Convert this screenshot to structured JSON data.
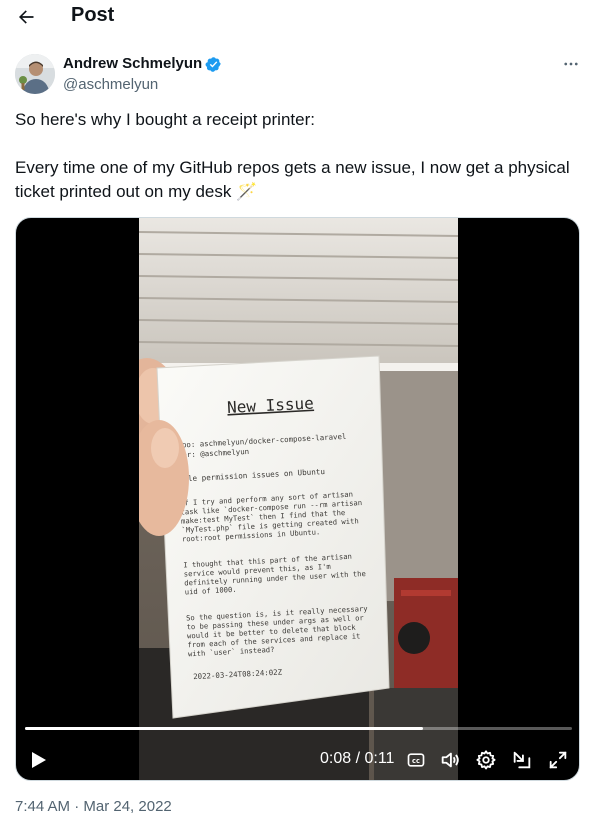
{
  "header": {
    "title": "Post"
  },
  "author": {
    "name": "Andrew Schmelyun",
    "handle": "@aschmelyun",
    "verified": true
  },
  "tweet": {
    "line1": "So here's why I bought a receipt printer:",
    "line2": "Every time one of my GitHub repos gets a new issue, I now get a physical",
    "line3": "ticket printed out on my desk 🪄"
  },
  "receipt": {
    "title": "New Issue",
    "repo": "Repo: aschmelyun/docker-compose-laravel",
    "user": "User: @aschmelyun",
    "issue_title": "File permission issues on Ubuntu",
    "body": [
      "If I try and perform any sort of artisan",
      "task like `docker-compose run --rm artisan",
      "make:test MyTest` then I find that the",
      "`MyTest.php` file is getting created with",
      "root:root permissions in Ubuntu.",
      "",
      "I thought that this part of the artisan",
      "service would prevent this, as I'm",
      "definitely running under the user with the",
      "uid of 1000.",
      "",
      "So the question is, is it really necessary",
      "to be passing these under args as well or",
      "would it be better to delete that block",
      "from each of the services and replace it",
      "with `user` instead?"
    ],
    "datetime": "2022-03-24T08:24:02Z"
  },
  "video": {
    "time": "0:08 / 0:11",
    "progress": 0.727
  },
  "icons": {
    "back": "arrow-left-icon",
    "more": "more-horizontal-icon",
    "verified": "verified-badge-icon",
    "play": "play-icon",
    "captions": "captions-icon",
    "volume": "volume-icon",
    "settings": "gear-icon",
    "pip": "picture-in-picture-icon",
    "fullscreen": "fullscreen-icon"
  },
  "colors": {
    "verified": "#1d9bf0",
    "text": "#0f1419",
    "secondary": "#536471"
  },
  "timestamp": "7:44 AM · Mar 24, 2022"
}
